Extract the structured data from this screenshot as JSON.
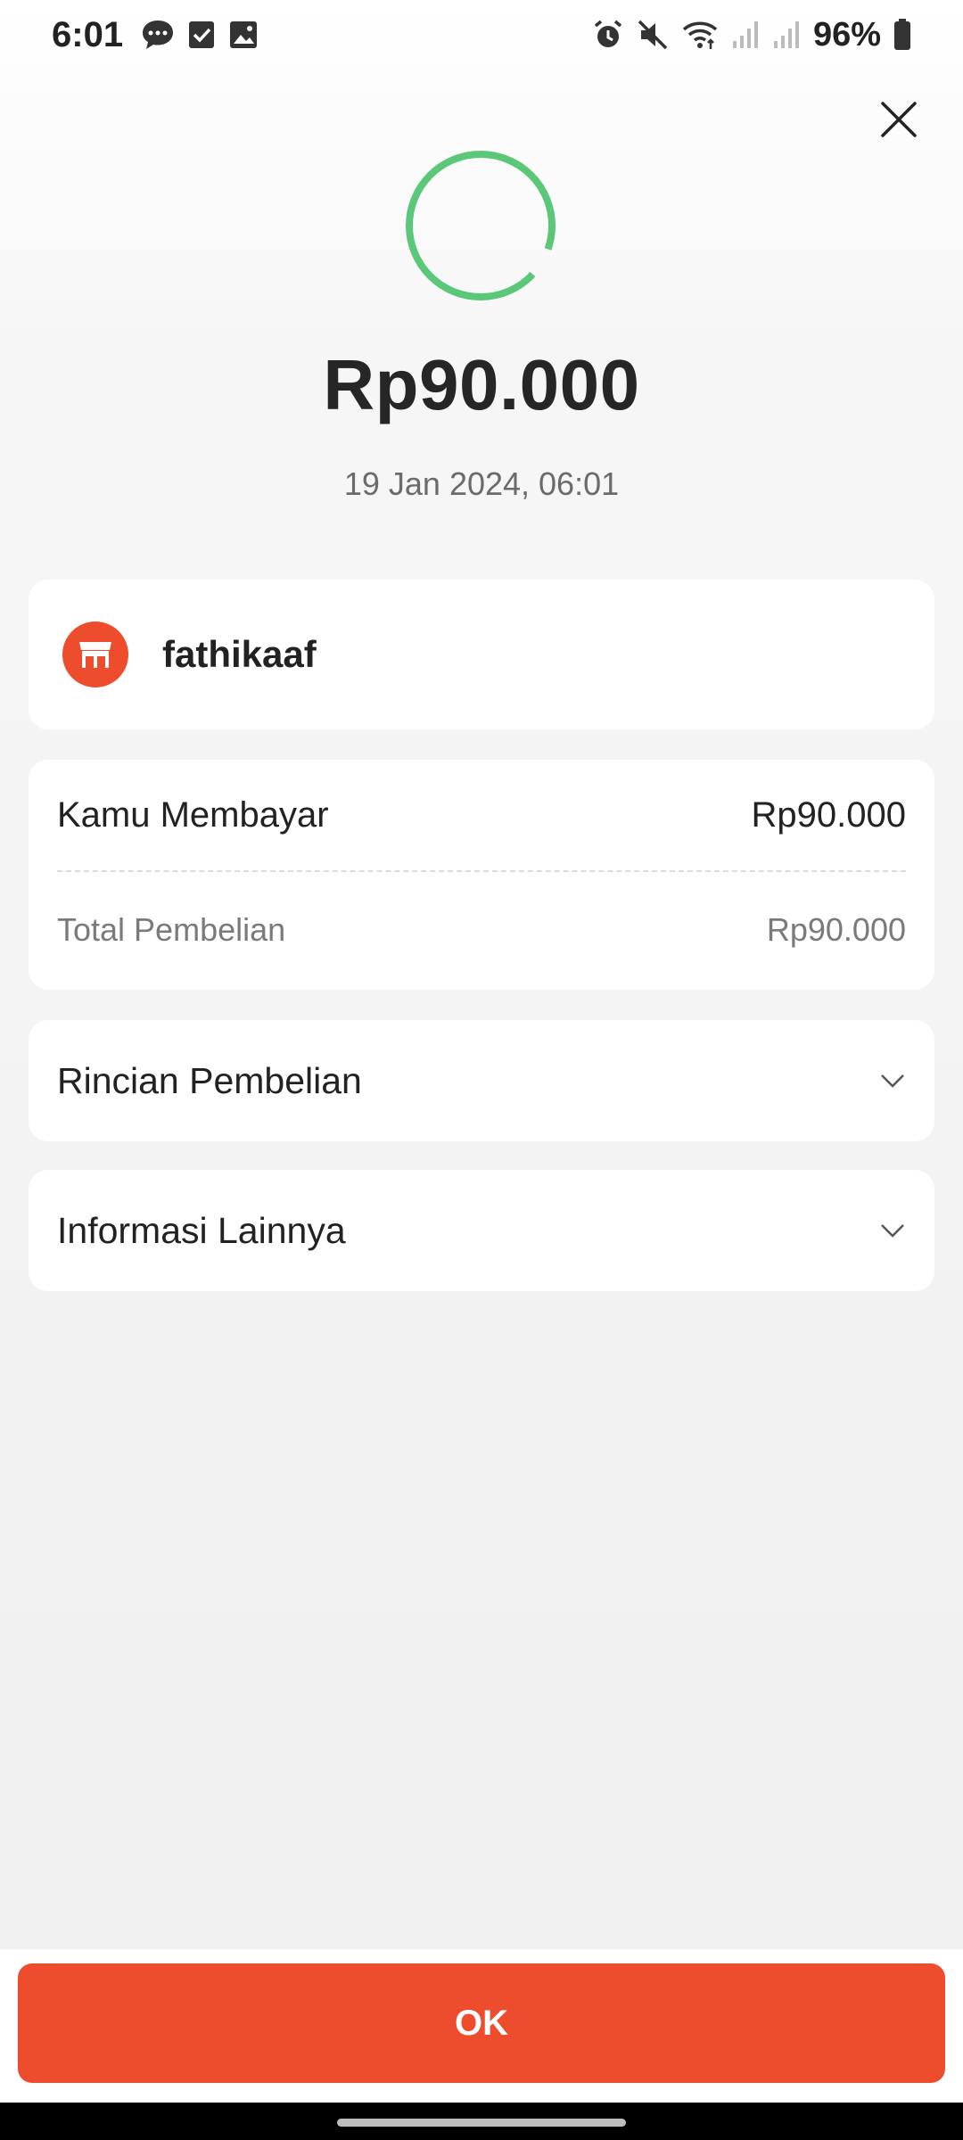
{
  "status_bar": {
    "time": "6:01",
    "battery": "96%",
    "left_icons": [
      "chat-bubble-icon",
      "checkbox-icon",
      "image-icon"
    ],
    "right_icons": [
      "alarm-icon",
      "mute-icon",
      "wifi-icon",
      "signal-icon",
      "signal-icon",
      "battery-icon"
    ]
  },
  "transaction": {
    "amount": "Rp90.000",
    "datetime": "19 Jan 2024, 06:01",
    "status_color": "#5ac878"
  },
  "merchant": {
    "name": "fathikaaf",
    "icon": "store-icon",
    "color": "#ee4d2d"
  },
  "payment": {
    "paid_label": "Kamu Membayar",
    "paid_value": "Rp90.000",
    "total_label": "Total Pembelian",
    "total_value": "Rp90.000"
  },
  "sections": [
    {
      "label": "Rincian Pembelian",
      "icon": "chevron-down-icon"
    },
    {
      "label": "Informasi Lainnya",
      "icon": "chevron-down-icon"
    }
  ],
  "footer": {
    "ok_label": "OK",
    "accent": "#ee4d2d"
  }
}
